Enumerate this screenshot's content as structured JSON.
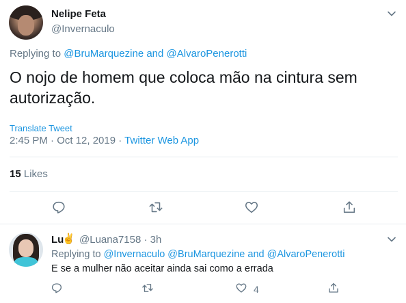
{
  "main_tweet": {
    "author_name": "Nelipe Feta",
    "author_handle": "@Invernaculo",
    "replying_prefix": "Replying to",
    "replying_user1": "@BruMarquezine",
    "replying_and": "and",
    "replying_user2": "@AlvaroPenerotti",
    "text": "O nojo de homem que coloca mão na cintura sem autorização.",
    "translate_label": "Translate Tweet",
    "timestamp": "2:45 PM · Oct 12, 2019 ·",
    "source": "Twitter Web App",
    "likes_count": "15",
    "likes_label": "Likes"
  },
  "reply": {
    "author_name": "Lu",
    "author_emoji": "✌️",
    "author_handle": "@Luana7158 · 3h",
    "replying_prefix": "Replying to",
    "replying_user1": "@Invernaculo",
    "replying_user2": "@BruMarquezine",
    "replying_and": "and",
    "replying_user3": "@AlvaroPenerotti",
    "text": "E se a mulher não aceitar ainda sai como a errada",
    "like_count": "4"
  },
  "icons": [
    "reply-icon",
    "retweet-icon",
    "like-icon",
    "share-icon",
    "chevron-down-icon"
  ],
  "colors": {
    "link": "#1b95e0",
    "muted": "#657786",
    "text": "#14171a",
    "divider": "#e6ecf0"
  }
}
